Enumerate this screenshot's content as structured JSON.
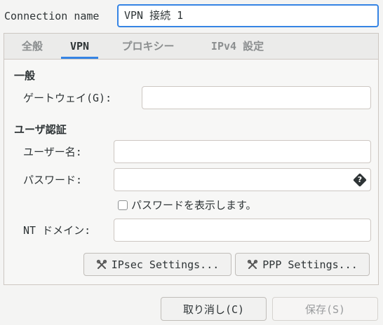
{
  "connection": {
    "label": "Connection name",
    "value": "VPN 接続 1"
  },
  "tabs": [
    {
      "label": "全般",
      "active": false
    },
    {
      "label": "VPN",
      "active": true
    },
    {
      "label": "プロキシー",
      "active": false
    },
    {
      "label": "IPv4 設定",
      "active": false
    }
  ],
  "general": {
    "heading": "一般",
    "gateway_label": "ゲートウェイ(G):",
    "gateway_value": ""
  },
  "auth": {
    "heading": "ユーザ認証",
    "username_label": "ユーザー名:",
    "username_value": "",
    "password_label": "パスワード:",
    "password_value": "",
    "show_password_label": "パスワードを表示します。",
    "show_password_checked": false,
    "nt_domain_label": "NT ドメイン:",
    "nt_domain_value": ""
  },
  "settings_buttons": {
    "ipsec": "IPsec Settings...",
    "ppp": "PPP Settings..."
  },
  "dialog_buttons": {
    "cancel": "取り消し(C)",
    "save": "保存(S)"
  },
  "colors": {
    "accent": "#3584e4",
    "background": "#f4f4f3"
  },
  "icons": {
    "password_field": "password-options-icon",
    "settings": "tools-icon"
  }
}
